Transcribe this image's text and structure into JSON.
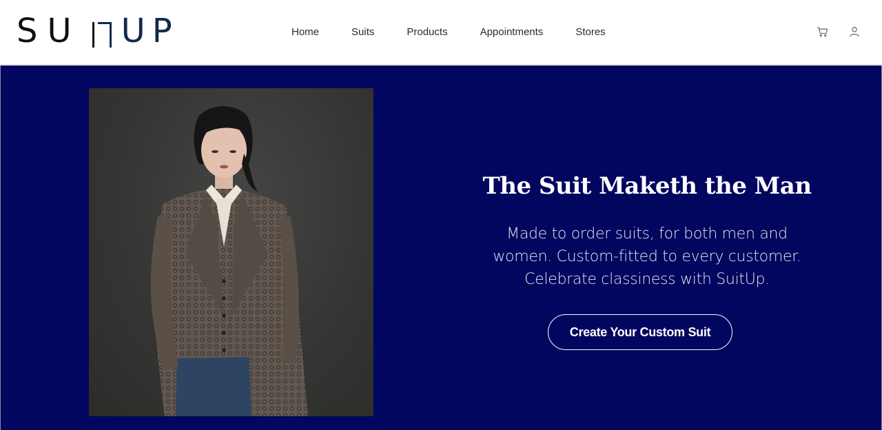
{
  "brand": {
    "logo_text_a": "SU",
    "logo_text_b": "UP",
    "logo_alt": "SUITUP"
  },
  "nav": {
    "items": [
      {
        "label": "Home"
      },
      {
        "label": "Suits"
      },
      {
        "label": "Products"
      },
      {
        "label": "Appointments"
      },
      {
        "label": "Stores"
      }
    ]
  },
  "header_icons": {
    "cart": "shopping-cart-icon",
    "account": "user-account-icon"
  },
  "hero": {
    "headline": "The Suit Maketh the Man",
    "subtext_lines": [
      "Made to order suits, for both men and",
      "women. Custom-fitted to every customer.",
      "Celebrate classiness with SuitUp."
    ],
    "cta_label": "Create Your Custom Suit",
    "background_color": "#03065f"
  }
}
